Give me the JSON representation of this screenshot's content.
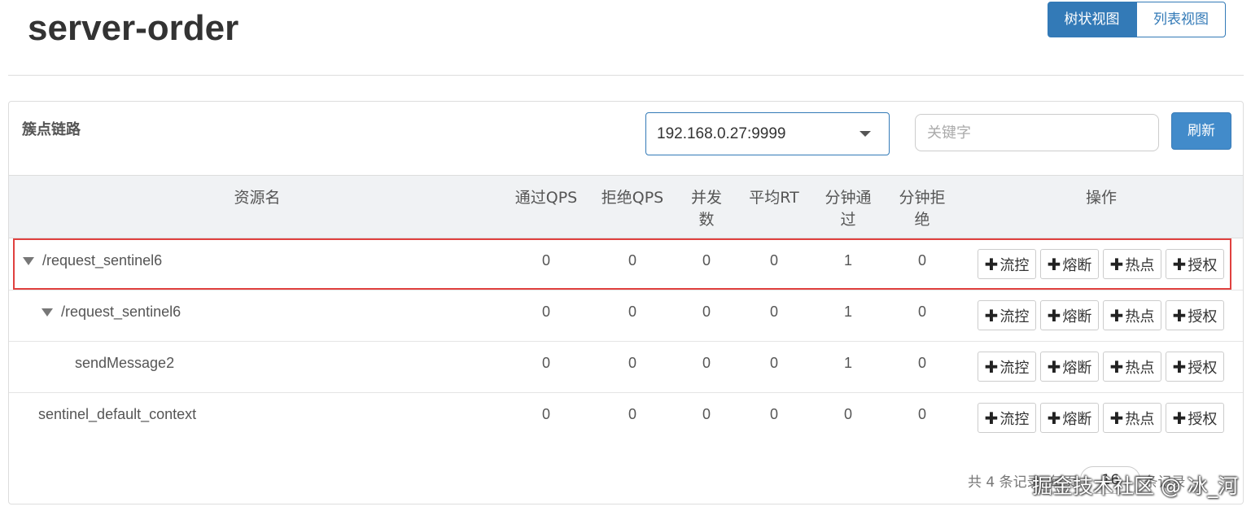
{
  "header": {
    "title": "server-order",
    "views": [
      {
        "label": "树状视图",
        "active": true
      },
      {
        "label": "列表视图",
        "active": false
      }
    ]
  },
  "panel": {
    "title": "簇点链路",
    "machine": "192.168.0.27:9999",
    "keyword_placeholder": "关键字",
    "refresh_label": "刷新"
  },
  "table": {
    "columns": {
      "resource": "资源名",
      "pass_qps": "通过QPS",
      "block_qps": "拒绝QPS",
      "thread_l1": "并发",
      "thread_l2": "数",
      "avg_rt": "平均RT",
      "min_pass_l1": "分钟通",
      "min_pass_l2": "过",
      "min_block_l1": "分钟拒",
      "min_block_l2": "绝",
      "ops": "操作"
    },
    "rows": [
      {
        "name": "/request_sentinel6",
        "pass_qps": "0",
        "block_qps": "0",
        "threads": "0",
        "avg_rt": "0",
        "min_pass": "1",
        "min_block": "0"
      },
      {
        "name": "/request_sentinel6",
        "pass_qps": "0",
        "block_qps": "0",
        "threads": "0",
        "avg_rt": "0",
        "min_pass": "1",
        "min_block": "0"
      },
      {
        "name": "sendMessage2",
        "pass_qps": "0",
        "block_qps": "0",
        "threads": "0",
        "avg_rt": "0",
        "min_pass": "1",
        "min_block": "0"
      },
      {
        "name": "sentinel_default_context",
        "pass_qps": "0",
        "block_qps": "0",
        "threads": "0",
        "avg_rt": "0",
        "min_pass": "0",
        "min_block": "0"
      }
    ],
    "actions": {
      "flow": "流控",
      "degrade": "熔断",
      "hotspot": "热点",
      "auth": "授权",
      "plus_glyph": "✚"
    }
  },
  "footer": {
    "prefix": "共 4 条记录, 每页",
    "page_size": "16",
    "suffix": "条记录"
  },
  "watermark": "掘金技术社区 @ 冰_河",
  "colors": {
    "primary": "#337ab7",
    "highlight_border": "#e0413f"
  }
}
